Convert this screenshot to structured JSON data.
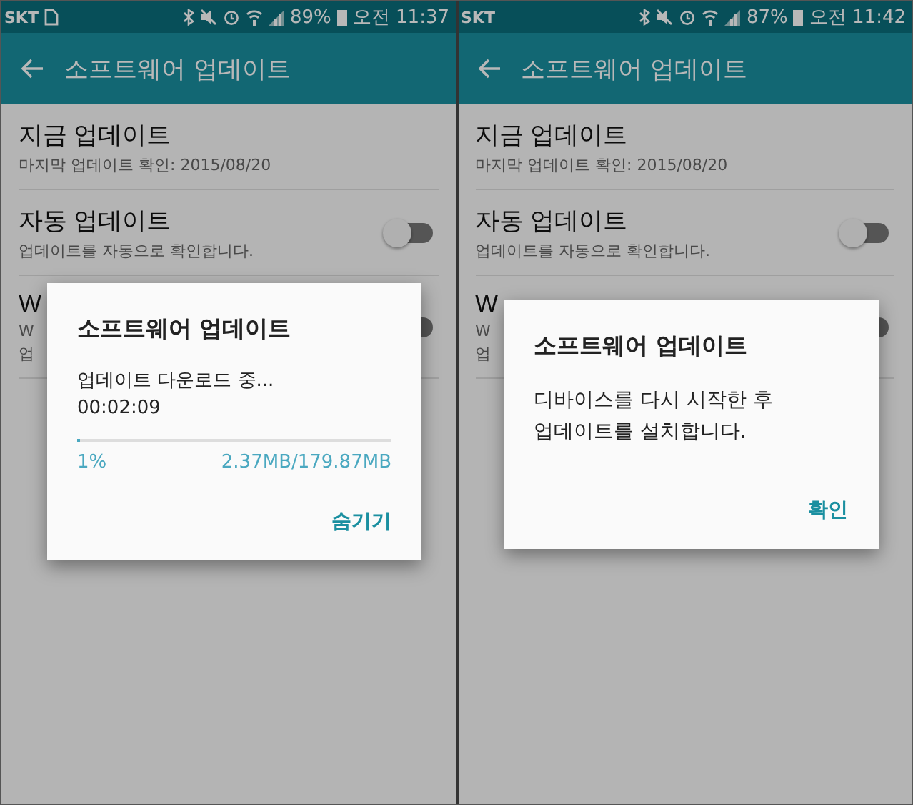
{
  "screens": [
    {
      "status_bar": {
        "carrier": "SKT",
        "show_sim_icon": true,
        "battery": "89%",
        "time": "오전 11:37"
      },
      "app_bar": {
        "title": "소프트웨어 업데이트"
      },
      "items": [
        {
          "kind": "plain",
          "title": "지금 업데이트",
          "subtitle": "마지막 업데이트 확인: 2015/08/20"
        },
        {
          "kind": "toggle",
          "title": "자동 업데이트",
          "subtitle": "업데이트를 자동으로 확인합니다.",
          "on": false
        },
        {
          "kind": "toggle",
          "title": "W",
          "subtitle": "W",
          "subtitle_2": "업",
          "on": false
        }
      ],
      "dialog": {
        "kind": "progress",
        "title": "소프트웨어 업데이트",
        "message": "업데이트 다운로드 중...",
        "elapsed": "00:02:09",
        "level": 0.01,
        "percent": "1%",
        "size": "2.37MB/179.87MB",
        "button": "숨기기"
      }
    },
    {
      "status_bar": {
        "carrier": "SKT",
        "show_sim_icon": false,
        "battery": "87%",
        "time": "오전 11:42"
      },
      "app_bar": {
        "title": "소프트웨어 업데이트"
      },
      "items": [
        {
          "kind": "plain",
          "title": "지금 업데이트",
          "subtitle": "마지막 업데이트 확인: 2015/08/20"
        },
        {
          "kind": "toggle",
          "title": "자동 업데이트",
          "subtitle": "업데이트를 자동으로 확인합니다.",
          "on": false
        },
        {
          "kind": "toggle",
          "title": "W",
          "subtitle": "W",
          "subtitle_2": "업",
          "on": false
        }
      ],
      "dialog": {
        "kind": "message",
        "title": "소프트웨어 업데이트",
        "lines": [
          "디바이스를 다시 시작한 후",
          "업데이트를 설치합니다."
        ],
        "button": "확인"
      }
    }
  ]
}
